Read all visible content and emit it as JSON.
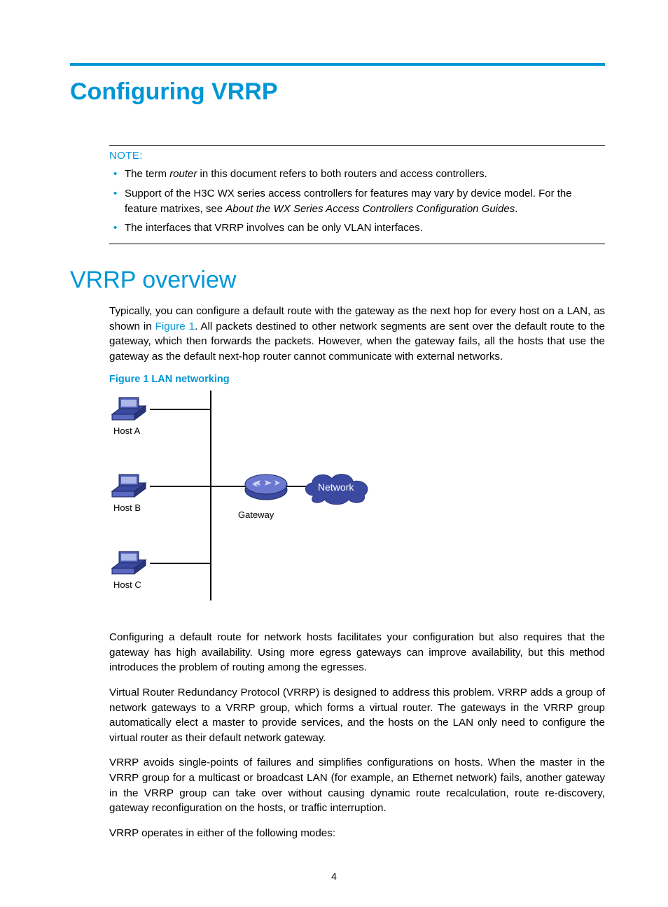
{
  "title": "Configuring VRRP",
  "note": {
    "label": "NOTE:",
    "items": [
      {
        "pre": "The term ",
        "ital": "router",
        "post": " in this document refers to both routers and access controllers."
      },
      {
        "pre": "Support of the H3C WX series access controllers for features may vary by device model. For the feature matrixes, see ",
        "ital": "About the WX Series Access Controllers Configuration Guides",
        "post": "."
      },
      {
        "pre": "The interfaces that VRRP involves can be only VLAN interfaces.",
        "ital": "",
        "post": ""
      }
    ]
  },
  "h2": "VRRP overview",
  "p1a": "Typically, you can configure a default route with the gateway as the next hop for every host on a LAN, as shown in ",
  "p1_link": "Figure 1",
  "p1b": ". All packets destined to other network segments are sent over the default route to the gateway, which then forwards the packets. However, when the gateway fails, all the hosts that use the gateway as the default next-hop router cannot communicate with external networks.",
  "figure_caption": "Figure 1 LAN networking",
  "diagram": {
    "hostA": "Host A",
    "hostB": "Host B",
    "hostC": "Host C",
    "gateway": "Gateway",
    "network": "Network"
  },
  "p2": "Configuring a default route for network hosts facilitates your configuration but also requires that the gateway has high availability. Using more egress gateways can improve availability, but this method introduces the problem of routing among the egresses.",
  "p3": "Virtual Router Redundancy Protocol (VRRP) is designed to address this problem. VRRP adds a group of network gateways to a VRRP group, which forms a virtual router. The gateways in the VRRP group automatically elect a master to provide services, and the hosts on the LAN only need to configure the virtual router as their default network gateway.",
  "p4": "VRRP avoids single-points of failures and simplifies configurations on hosts. When the master in the VRRP group for a multicast or broadcast LAN (for example, an Ethernet network) fails, another gateway in the VRRP group can take over without causing dynamic route recalculation, route re-discovery, gateway reconfiguration on the hosts, or traffic interruption.",
  "p5": "VRRP operates in either of the following modes:",
  "pagenum": "4"
}
